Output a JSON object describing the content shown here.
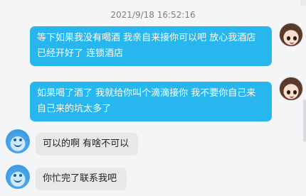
{
  "chat": {
    "timestamp": "2021/9/18 16:52:16",
    "messages": [
      {
        "side": "out",
        "text": "等下如果我没有喝酒 我亲自来接你可以吧 放心我酒店已经开好了 连锁酒店"
      },
      {
        "side": "out",
        "text": "如果喝了酒了 我就给你叫个滴滴接你  我不要你自己来 自己来的坑太多了"
      },
      {
        "side": "in",
        "text": "可以的啊 有啥不可以"
      },
      {
        "side": "in",
        "text": "你忙完了联系我吧"
      }
    ]
  }
}
